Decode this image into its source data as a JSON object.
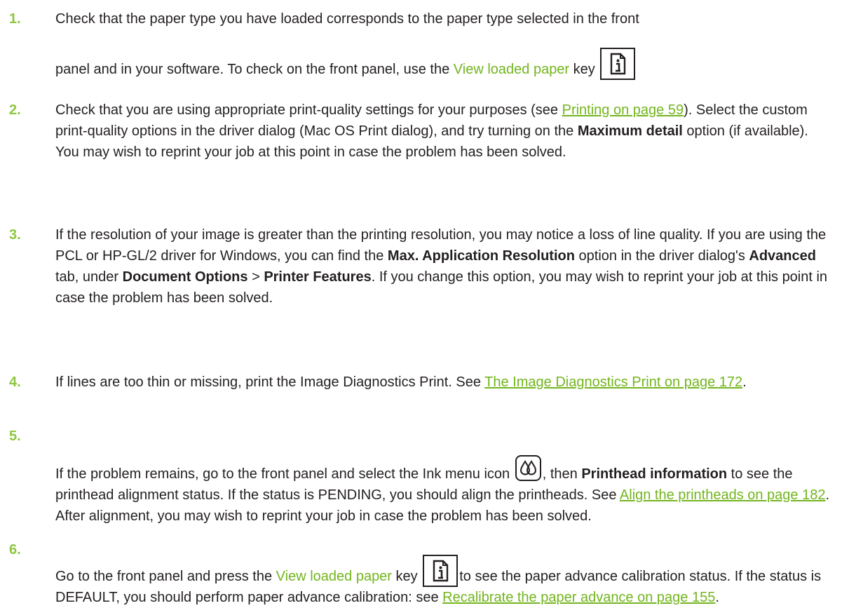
{
  "colors": {
    "accent": "#73b51e",
    "number": "#8dc63f",
    "text": "#231f20"
  },
  "icons": {
    "view_loaded_paper_key": "paper-info-key-icon",
    "ink_menu": "ink-drops-icon"
  },
  "steps": [
    {
      "number": "1.",
      "line1": "Check that the paper type you have loaded corresponds to the paper type selected in the front",
      "line2_a": "panel and in your software. To check on the front panel, use the ",
      "key_text": "View loaded paper",
      "line2_b": " key "
    },
    {
      "number": "2.",
      "a": "Check that you are using appropriate print-quality settings for your purposes (see ",
      "link": "Printing on page 59",
      "b": "). Select the custom print-quality options in the driver dialog (Mac OS Print dialog), and try turning on the ",
      "bold1": "Maximum detail",
      "c": " option (if available). You may wish to reprint your job at this point in case the problem has been solved."
    },
    {
      "number": "3.",
      "a": "If the resolution of your image is greater than the printing resolution, you may notice a loss of line quality. If you are using the PCL or HP-GL/2 driver for Windows, you can find the ",
      "bold1": "Max. Application Resolution",
      "b": " option in the driver dialog's ",
      "bold2": "Advanced",
      "c": " tab, under ",
      "bold3": "Document Options",
      "d": " > ",
      "bold4": "Printer Features",
      "e": ". If you change this option, you may wish to reprint your job at this point in case the problem has been solved."
    },
    {
      "number": "4.",
      "a": "If lines are too thin or missing, print the Image Diagnostics Print. See ",
      "link": "The Image Diagnostics Print on page 172",
      "b": "."
    },
    {
      "number": "5.",
      "a": "If the problem remains, go to the front panel and select the Ink menu icon ",
      "b": ", then ",
      "bold1": "Printhead information",
      "c": " to see the printhead alignment status. If the status is PENDING, you should align the printheads. See ",
      "link": "Align the printheads on page 182",
      "d": ". After alignment, you may wish to reprint your job in case the problem has been solved."
    },
    {
      "number": "6.",
      "a": "Go to the front panel and press the ",
      "key_text": "View loaded paper",
      "b": " key ",
      "c": "to see the paper advance calibration status. If the status is DEFAULT, you should perform paper advance calibration: see ",
      "link": "Recalibrate the paper advance on page 155",
      "d": "."
    }
  ]
}
